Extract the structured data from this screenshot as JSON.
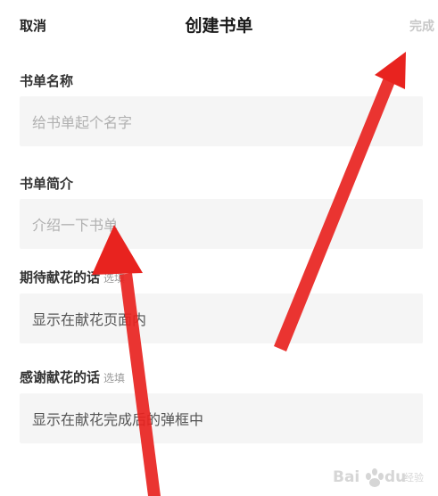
{
  "header": {
    "cancel_label": "取消",
    "title": "创建书单",
    "done_label": "完成"
  },
  "form": {
    "name": {
      "label": "书单名称",
      "placeholder": "给书单起个名字"
    },
    "intro": {
      "label": "书单简介",
      "placeholder": "介绍一下书单"
    },
    "expect": {
      "label": "期待献花的话",
      "optional": "选填",
      "placeholder": "显示在献花页面内"
    },
    "thanks": {
      "label": "感谢献花的话",
      "optional": "选填",
      "placeholder": "显示在献花完成后的弹框中"
    }
  },
  "watermark": {
    "text": "Baidu 经验"
  },
  "colors": {
    "annotation_arrow": "#e8231f",
    "field_background": "#f5f5f5",
    "done_disabled": "#c8c8c8"
  }
}
